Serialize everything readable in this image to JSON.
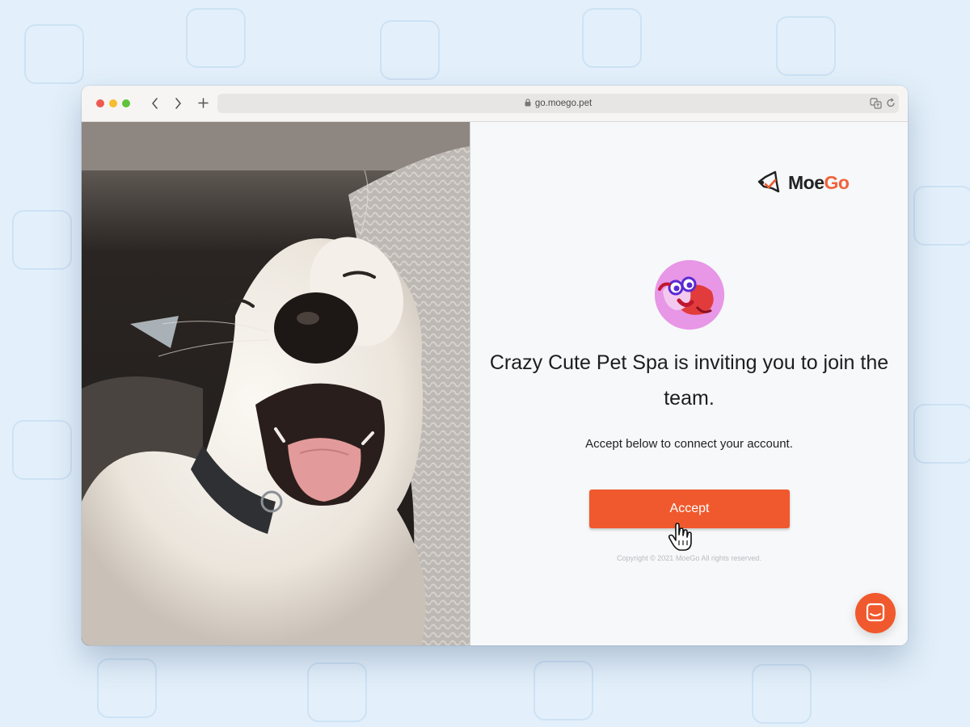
{
  "browser": {
    "url": "go.moego.pet",
    "back_icon": "chevron-left-icon",
    "forward_icon": "chevron-right-icon",
    "new_tab_icon": "plus-icon"
  },
  "brand": {
    "name_part1": "Moe",
    "name_part2": "Go",
    "accent_color": "#f0592d"
  },
  "invite": {
    "title": "Crazy Cute Pet Spa is inviting you to join the team.",
    "subtitle": "Accept below to connect your account.",
    "accept_label": "Accept",
    "copyright": "Copyright © 2021 MoeGo All rights reserved."
  },
  "chat": {
    "icon": "chat-icon"
  }
}
